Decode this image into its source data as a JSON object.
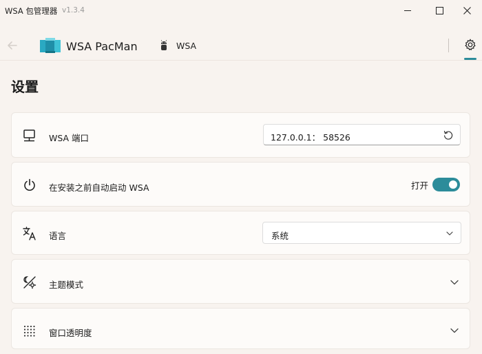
{
  "window": {
    "title": "WSA 包管理器",
    "version": "v1.3.4"
  },
  "header": {
    "app_name": "WSA PacMan",
    "device_label": "WSA"
  },
  "page": {
    "title": "设置"
  },
  "settings": {
    "port": {
      "label": "WSA 端口",
      "value": "127.0.0.1： 58526"
    },
    "autostart": {
      "label": "在安装之前自动启动 WSA",
      "state_label": "打开",
      "enabled": true
    },
    "language": {
      "label": "语言",
      "selected": "系统"
    },
    "theme": {
      "label": "主题模式"
    },
    "opacity": {
      "label": "窗口透明度"
    }
  },
  "colors": {
    "accent": "#2c8c9a",
    "background": "#f8f3ef",
    "card": "#fdfbf9"
  },
  "icons": {
    "back": "arrow-left-icon",
    "logo": "package-cube-icon",
    "device": "android-robot-icon",
    "settings": "gear-icon",
    "port": "monitor-icon",
    "autostart": "power-icon",
    "language": "translate-icon",
    "theme": "theme-icon",
    "opacity": "dot-grid-icon",
    "reset": "reset-icon",
    "chevron": "chevron-down-icon"
  }
}
